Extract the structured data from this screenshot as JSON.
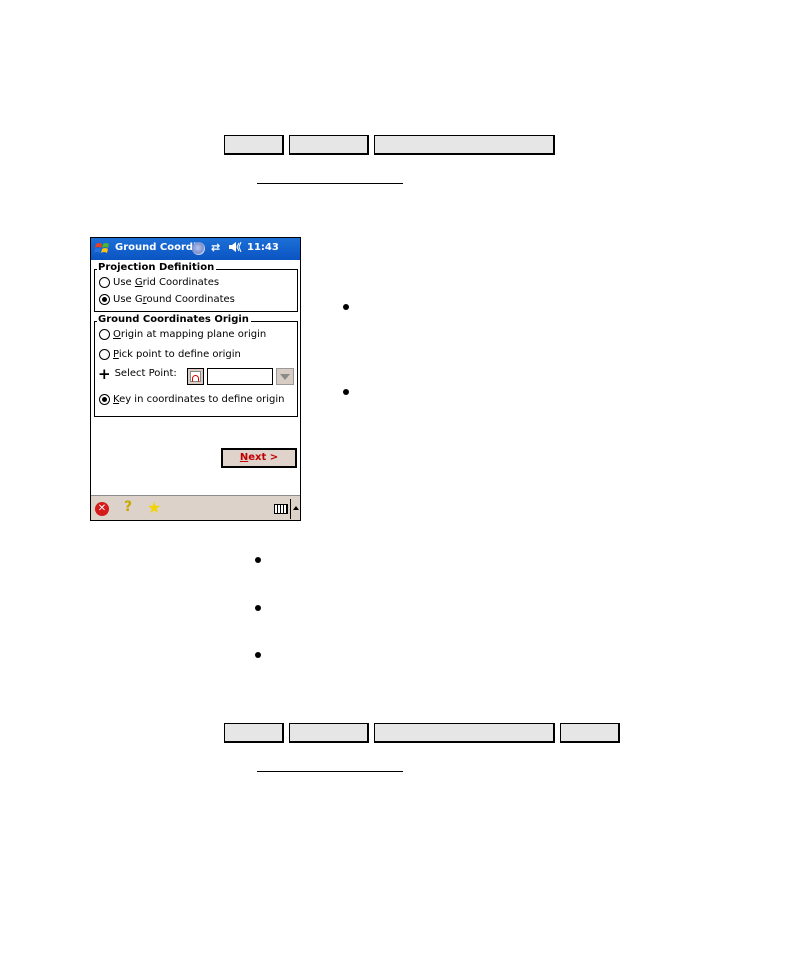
{
  "top_nav": {
    "buttons": [
      {
        "label": ""
      },
      {
        "label": ""
      },
      {
        "label": ""
      }
    ],
    "link_text": ""
  },
  "bottom_nav": {
    "buttons": [
      {
        "label": ""
      },
      {
        "label": ""
      },
      {
        "label": ""
      },
      {
        "label": ""
      }
    ],
    "link_text": ""
  },
  "pda": {
    "titlebar": {
      "start_icon": "windows-flag-icon",
      "title": "Ground Coordi",
      "sync_icon": "activesync-icon",
      "connection_icon": "connectivity-arrows-icon",
      "connection_glyph": "⇄",
      "volume_icon": "speaker-icon",
      "volume_glyph": "◀€",
      "time": "11:43"
    },
    "projection_definition": {
      "legend": "Projection Definition",
      "options": [
        {
          "pre": "Use ",
          "accel": "G",
          "post": "rid Coordinates",
          "selected": false
        },
        {
          "pre": "Use G",
          "accel": "r",
          "post": "ound Coordinates",
          "selected": true
        }
      ]
    },
    "ground_origin": {
      "legend": "Ground Coordinates Origin",
      "options": [
        {
          "pre": "",
          "accel": "O",
          "post": "rigin at mapping plane origin",
          "selected": false
        },
        {
          "pre": "",
          "accel": "P",
          "post": "ick point to define origin",
          "selected": false
        },
        {
          "pre": "",
          "accel": "K",
          "post": "ey in coordinates to define origin",
          "selected": true
        }
      ],
      "select_point_label": "Select Point:",
      "select_point_value": "",
      "plus_glyph": "+"
    },
    "next_button": {
      "accel": "N",
      "rest": "ext >"
    },
    "taskbar": {
      "close_glyph": "✕",
      "help_glyph": "?",
      "favorites_glyph": "★"
    }
  },
  "side_bullets": [
    "",
    ""
  ],
  "bottom_bullets": [
    "",
    "",
    ""
  ],
  "colors": {
    "titlebar": "#0a5fcf",
    "next_text": "#c00000",
    "taskbar": "#dcd2c9",
    "nav_button_fill": "#e6e6e6"
  }
}
